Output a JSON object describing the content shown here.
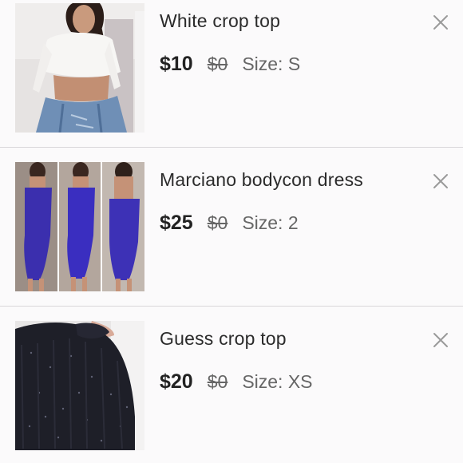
{
  "items": [
    {
      "title": "White crop top",
      "price": "$10",
      "original_price": "$0",
      "size": "Size: S",
      "thumbnail_icon": "white-crop-top-photo",
      "remove_icon": "close-icon"
    },
    {
      "title": "Marciano bodycon dress",
      "price": "$25",
      "original_price": "$0",
      "size": "Size: 2",
      "thumbnail_icon": "blue-bodycon-dress-photo",
      "remove_icon": "close-icon"
    },
    {
      "title": "Guess crop top",
      "price": "$20",
      "original_price": "$0",
      "size": "Size: XS",
      "thumbnail_icon": "black-knit-crop-top-photo",
      "remove_icon": "close-icon"
    }
  ],
  "colors": {
    "background": "#fbfafb",
    "divider": "#d9d7da",
    "text": "#2b2b2b",
    "close_icon": "#9a9a9a"
  }
}
